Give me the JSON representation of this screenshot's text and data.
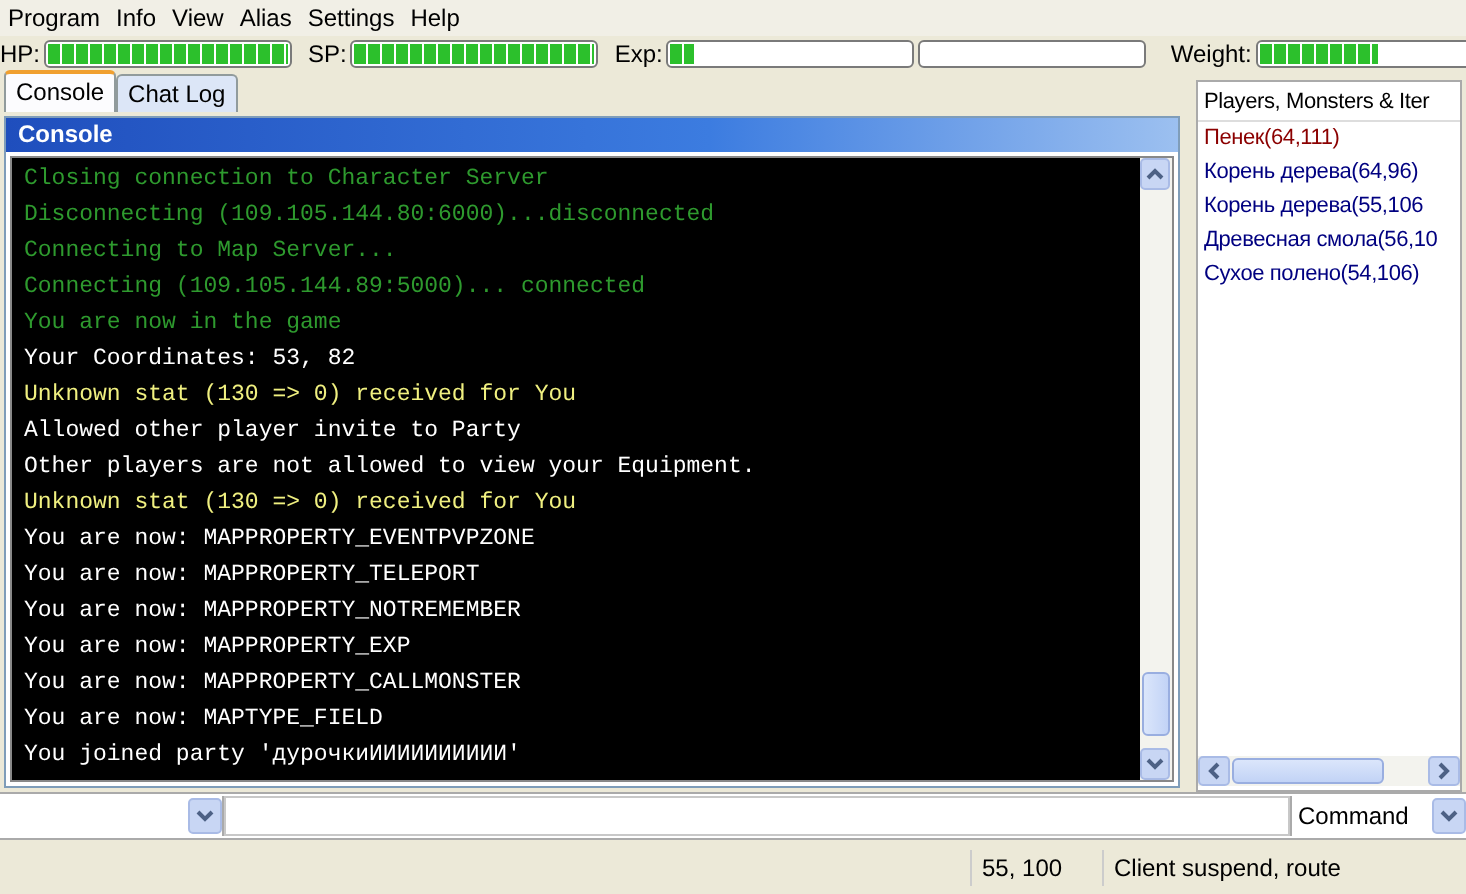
{
  "menu": [
    {
      "label": "Program"
    },
    {
      "label": "Info"
    },
    {
      "label": "View"
    },
    {
      "label": "Alias"
    },
    {
      "label": "Settings"
    },
    {
      "label": "Help"
    }
  ],
  "stats": [
    {
      "label": "HP:",
      "bars": [
        {
          "level": 1
        }
      ]
    },
    {
      "label": "SP:",
      "bars": [
        {
          "level": 1
        }
      ]
    },
    {
      "label": "Exp:",
      "bars": [
        {
          "level": 0.1
        },
        {
          "level": 0
        }
      ]
    },
    {
      "label": "Weight:",
      "bars": [
        {
          "level": 0.48
        }
      ]
    }
  ],
  "tabs": [
    {
      "label": "Console",
      "selected": true
    },
    {
      "label": "Chat Log",
      "selected": false
    }
  ],
  "console": {
    "title": "Console",
    "lines": [
      {
        "text": "Closing connection to Character Server",
        "color": "#2e9a2e"
      },
      {
        "text": "Disconnecting (109.105.144.80:6000)...disconnected",
        "color": "#2e9a2e"
      },
      {
        "text": "Connecting to Map Server...",
        "color": "#2e9a2e"
      },
      {
        "text": "Connecting (109.105.144.89:5000)... connected",
        "color": "#2e9a2e"
      },
      {
        "text": "You are now in the game",
        "color": "#2e9a2e"
      },
      {
        "text": "Your Coordinates: 53, 82",
        "color": "#ffffff"
      },
      {
        "text": "Unknown stat (130 => 0) received for You",
        "color": "#f0f080"
      },
      {
        "text": "Allowed other player invite to Party",
        "color": "#ffffff"
      },
      {
        "text": "Other players are not allowed to view your Equipment.",
        "color": "#ffffff"
      },
      {
        "text": "Unknown stat (130 => 0) received for You",
        "color": "#f0f080"
      },
      {
        "text": "You are now: MAPPROPERTY_EVENTPVPZONE",
        "color": "#ffffff"
      },
      {
        "text": "You are now: MAPPROPERTY_TELEPORT",
        "color": "#ffffff"
      },
      {
        "text": "You are now: MAPPROPERTY_NOTREMEMBER",
        "color": "#ffffff"
      },
      {
        "text": "You are now: MAPPROPERTY_EXP",
        "color": "#ffffff"
      },
      {
        "text": "You are now: MAPPROPERTY_CALLMONSTER",
        "color": "#ffffff"
      },
      {
        "text": "You are now: MAPTYPE_FIELD",
        "color": "#ffffff"
      },
      {
        "text": "You joined party 'дурочкиИИИИИИИИИИ'",
        "color": "#ffffff"
      }
    ]
  },
  "side_panel": {
    "title": "Players, Monsters & Iter",
    "items": [
      {
        "text": "Пенек(64,111)",
        "color": "#8b0000"
      },
      {
        "text": "Корень дерева(64,96)",
        "color": "#000080"
      },
      {
        "text": "Корень дерева(55,106",
        "color": "#000080"
      },
      {
        "text": "Древесная смола(56,10",
        "color": "#000080"
      },
      {
        "text": "Сухое полено(54,106)",
        "color": "#000080"
      }
    ]
  },
  "command_bar": {
    "mode": "Command"
  },
  "status_bar": {
    "coordinates": "55, 100",
    "status": "Client suspend, route"
  }
}
